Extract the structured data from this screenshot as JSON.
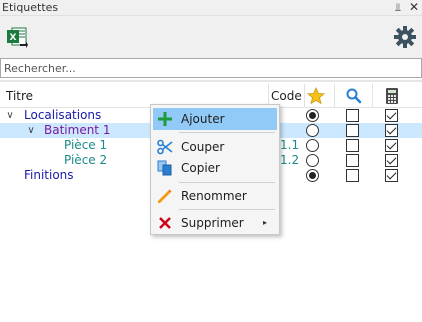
{
  "window": {
    "title": "Etiquettes",
    "pin_glyph": "⫫",
    "close_glyph": "✕"
  },
  "toolbar": {
    "export_icon": "excel-export-icon",
    "settings_icon": "gear-icon"
  },
  "search": {
    "placeholder": "Rechercher...",
    "value": ""
  },
  "columns": {
    "title": "Titre",
    "code": "Code",
    "icons": [
      "star-icon",
      "search-icon",
      "calculator-icon"
    ]
  },
  "tree": [
    {
      "label": "Localisations",
      "code": "",
      "radio": true,
      "check1": false,
      "check2": true,
      "expanded": true,
      "color": "#1a1aaa"
    },
    {
      "label": "Batiment 1",
      "code": "",
      "radio": false,
      "check1": false,
      "check2": true,
      "expanded": true,
      "selected": true,
      "color": "#7a1aa0"
    },
    {
      "label": "Pièce 1",
      "code": "1.1",
      "radio": false,
      "check1": false,
      "check2": true,
      "color": "#1a8a8a"
    },
    {
      "label": "Pièce 2",
      "code": "1.2",
      "radio": false,
      "check1": false,
      "check2": true,
      "color": "#1a8a8a"
    },
    {
      "label": "Finitions",
      "code": "",
      "radio": true,
      "check1": false,
      "check2": true,
      "color": "#1a1aaa"
    }
  ],
  "context_menu": {
    "items": [
      {
        "label": "Ajouter",
        "icon": "plus-icon"
      },
      {
        "label": "Couper",
        "icon": "scissors-icon"
      },
      {
        "label": "Copier",
        "icon": "copy-icon"
      },
      {
        "label": "Renommer",
        "icon": "pencil-icon"
      },
      {
        "label": "Supprimer",
        "icon": "delete-x-icon",
        "submenu_arrow": "▸"
      }
    ]
  },
  "colors": {
    "accent_selected": "#cce8ff",
    "menu_hover": "#91c9f7",
    "excel_green": "#1d7a3e"
  }
}
